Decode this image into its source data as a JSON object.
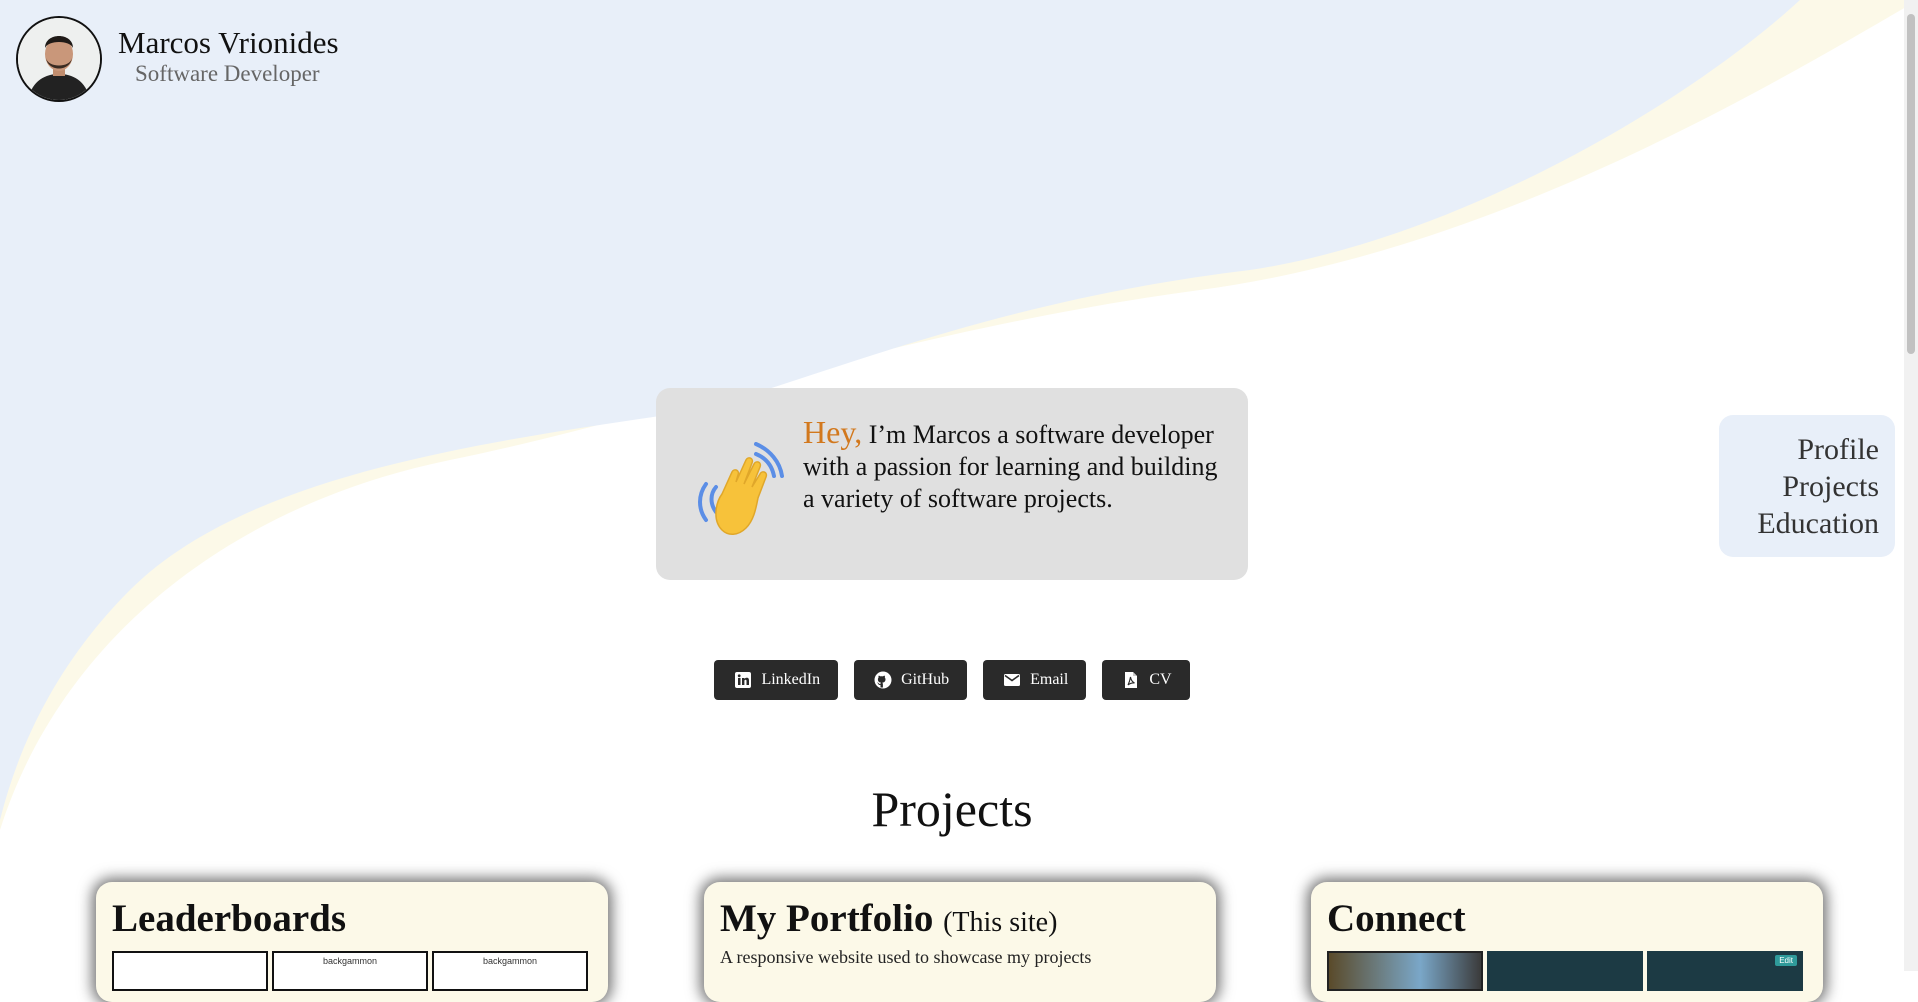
{
  "profile": {
    "name": "Marcos Vrionides",
    "role": "Software Developer"
  },
  "nav": {
    "items": [
      "Profile",
      "Projects",
      "Education"
    ]
  },
  "intro": {
    "greeting": "Hey,",
    "text": " I’m Marcos a software developer with a passion for learning and building a variety of software projects.",
    "icon": "waving-hand-icon"
  },
  "socials": [
    {
      "label": "LinkedIn",
      "icon": "linkedin-icon"
    },
    {
      "label": "GitHub",
      "icon": "github-icon"
    },
    {
      "label": "Email",
      "icon": "email-icon"
    },
    {
      "label": "CV",
      "icon": "pdf-icon"
    }
  ],
  "projects": {
    "title": "Projects",
    "cards": [
      {
        "title": "Leaderboards",
        "subtitle": "",
        "description": "",
        "thumb_labels": [
          "",
          "backgammon",
          "backgammon"
        ]
      },
      {
        "title": "My Portfolio",
        "subtitle": "(This site)",
        "description": "A responsive website used to showcase my projects"
      },
      {
        "title": "Connect",
        "subtitle": "",
        "description": "",
        "thumb_labels": [
          "",
          "",
          "Edit"
        ]
      }
    ]
  },
  "colors": {
    "top_wave": "#e8eff9",
    "cream_wave": "#fcf9e8",
    "accent": "#d2781d",
    "button_bg": "#2a2a2a"
  }
}
